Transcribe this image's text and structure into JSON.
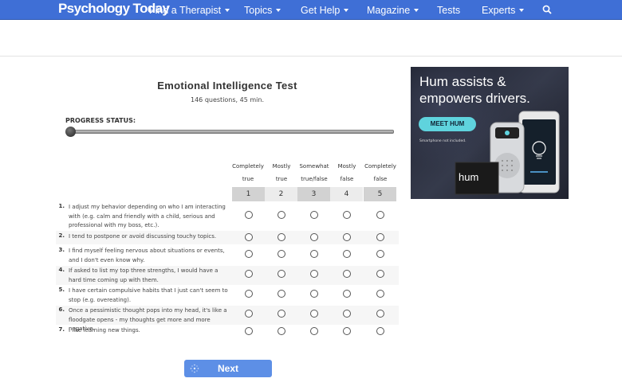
{
  "header": {
    "logo": "Psychology Today",
    "nav": [
      {
        "label": "Find a Therapist",
        "caret": true
      },
      {
        "label": "Topics",
        "caret": true
      },
      {
        "label": "Get Help",
        "caret": true
      },
      {
        "label": "Magazine",
        "caret": true
      },
      {
        "label": "Tests",
        "caret": false
      },
      {
        "label": "Experts",
        "caret": true
      }
    ],
    "search_icon": "search-icon"
  },
  "test": {
    "title": "Emotional Intelligence Test",
    "subtitle": "146 questions, 45 min.",
    "progress_label": "PROGRESS STATUS:",
    "progress_fraction": 0.0
  },
  "scale": {
    "columns": [
      {
        "line1": "Completely",
        "line2": "true",
        "number": "1"
      },
      {
        "line1": "Mostly",
        "line2": "true",
        "number": "2"
      },
      {
        "line1": "Somewhat",
        "line2": "true/false",
        "number": "3"
      },
      {
        "line1": "Mostly",
        "line2": "false",
        "number": "4"
      },
      {
        "line1": "Completely",
        "line2": "false",
        "number": "5"
      }
    ]
  },
  "questions": [
    {
      "num": "1.",
      "text": "I adjust my behavior depending on who I am interacting with (e.g. calm and friendly with a child, serious and professional with my boss, etc.)."
    },
    {
      "num": "2.",
      "text": "I tend to postpone or avoid discussing touchy topics."
    },
    {
      "num": "3.",
      "text": "I find myself feeling nervous about situations or events, and I don't even know why."
    },
    {
      "num": "4.",
      "text": "If asked to list my top three strengths, I would have a hard time coming up with them."
    },
    {
      "num": "5.",
      "text": "I have certain compulsive habits that I just can't seem to stop (e.g. overeating)."
    },
    {
      "num": "6.",
      "text": "Once a pessimistic thought pops into my head, it's like a floodgate opens - my thoughts get more and more negative."
    },
    {
      "num": "7.",
      "text": "I like learning new things."
    }
  ],
  "ad": {
    "headline": "Hum assists & empowers drivers.",
    "button": "MEET HUM",
    "note": "Smartphone not included.",
    "logo": "hum"
  },
  "footer": {
    "next_label": "Next"
  }
}
